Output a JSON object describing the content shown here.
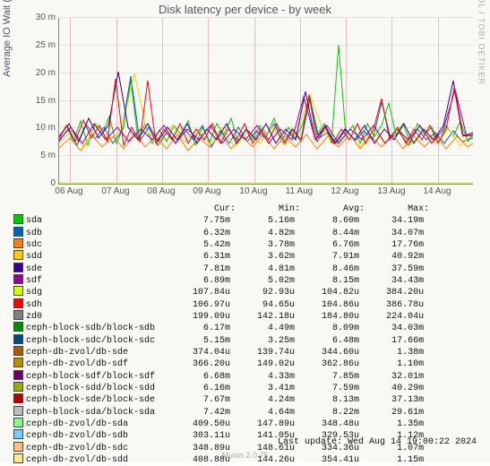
{
  "title": "Disk latency per device - by week",
  "ylabel": "Average IO Wait (seconds)",
  "watermark": "RRDTOOL / TOBI OETIKER",
  "footer_update": "Last update: Wed Aug 14 19:00:22 2024",
  "footer_version": "Munin 2.0.75",
  "chart_data": {
    "type": "line",
    "xlabel": "",
    "ylabel": "Average IO Wait (seconds)",
    "ylim_m": [
      0,
      30
    ],
    "yticks": [
      "0",
      "5 m",
      "10 m",
      "15 m",
      "20 m",
      "25 m",
      "30 m"
    ],
    "xticks": [
      "06 Aug",
      "07 Aug",
      "08 Aug",
      "09 Aug",
      "10 Aug",
      "11 Aug",
      "12 Aug",
      "13 Aug",
      "14 Aug"
    ],
    "time_range": [
      "2024-08-05T18:00",
      "2024-08-14T19:00"
    ],
    "legend_header": {
      "cur": "Cur:",
      "min": "Min:",
      "avg": "Avg:",
      "max": "Max:"
    },
    "series": [
      {
        "name": "sda",
        "color": "#00cc00",
        "cur": "7.75m",
        "min": "5.16m",
        "avg": "8.60m",
        "max": "34.19m"
      },
      {
        "name": "sdb",
        "color": "#0066b3",
        "cur": "6.32m",
        "min": "4.82m",
        "avg": "8.44m",
        "max": "34.07m"
      },
      {
        "name": "sdc",
        "color": "#ff8000",
        "cur": "5.42m",
        "min": "3.78m",
        "avg": "6.76m",
        "max": "17.76m"
      },
      {
        "name": "sdd",
        "color": "#ffcc00",
        "cur": "6.31m",
        "min": "3.62m",
        "avg": "7.91m",
        "max": "40.92m"
      },
      {
        "name": "sde",
        "color": "#330099",
        "cur": "7.81m",
        "min": "4.81m",
        "avg": "8.46m",
        "max": "37.59m"
      },
      {
        "name": "sdf",
        "color": "#990099",
        "cur": "6.89m",
        "min": "5.02m",
        "avg": "8.15m",
        "max": "34.43m"
      },
      {
        "name": "sdg",
        "color": "#ccff00",
        "cur": "107.84u",
        "min": "92.93u",
        "avg": "104.82u",
        "max": "384.20u"
      },
      {
        "name": "sdh",
        "color": "#ff0000",
        "cur": "106.97u",
        "min": "94.65u",
        "avg": "104.86u",
        "max": "386.78u"
      },
      {
        "name": "zd0",
        "color": "#808080",
        "cur": "199.09u",
        "min": "142.18u",
        "avg": "184.80u",
        "max": "224.04u"
      },
      {
        "name": "ceph-block-sdb/block-sdb",
        "color": "#008f00",
        "cur": "6.17m",
        "min": "4.49m",
        "avg": "8.09m",
        "max": "34.03m"
      },
      {
        "name": "ceph-block-sdc/block-sdc",
        "color": "#00487d",
        "cur": "5.15m",
        "min": "3.25m",
        "avg": "6.48m",
        "max": "17.66m"
      },
      {
        "name": "ceph-db-zvol/db-sde",
        "color": "#b35a00",
        "cur": "374.04u",
        "min": "139.74u",
        "avg": "344.60u",
        "max": "1.38m"
      },
      {
        "name": "ceph-db-zvol/db-sdf",
        "color": "#b38f00",
        "cur": "366.20u",
        "min": "149.02u",
        "avg": "362.86u",
        "max": "1.10m"
      },
      {
        "name": "ceph-block-sdf/block-sdf",
        "color": "#6b006b",
        "cur": "6.68m",
        "min": "4.33m",
        "avg": "7.85m",
        "max": "32.01m"
      },
      {
        "name": "ceph-block-sdd/block-sdd",
        "color": "#8fb300",
        "cur": "6.16m",
        "min": "3.41m",
        "avg": "7.59m",
        "max": "40.29m"
      },
      {
        "name": "ceph-block-sde/block-sde",
        "color": "#b30000",
        "cur": "7.67m",
        "min": "4.24m",
        "avg": "8.13m",
        "max": "37.13m"
      },
      {
        "name": "ceph-block-sda/block-sda",
        "color": "#bebebe",
        "cur": "7.42m",
        "min": "4.64m",
        "avg": "8.22m",
        "max": "29.61m"
      },
      {
        "name": "ceph-db-zvol/db-sda",
        "color": "#80ff80",
        "cur": "409.50u",
        "min": "147.89u",
        "avg": "348.48u",
        "max": "1.35m"
      },
      {
        "name": "ceph-db-zvol/db-sdb",
        "color": "#80c9ff",
        "cur": "303.11u",
        "min": "141.05u",
        "avg": "329.53u",
        "max": "1.12m"
      },
      {
        "name": "ceph-db-zvol/db-sdc",
        "color": "#ffc080",
        "cur": "348.89u",
        "min": "148.61u",
        "avg": "334.36u",
        "max": "1.07m"
      },
      {
        "name": "ceph-db-zvol/db-sdd",
        "color": "#ffe680",
        "cur": "408.88u",
        "min": "144.26u",
        "avg": "354.41u",
        "max": "1.15m"
      }
    ]
  }
}
